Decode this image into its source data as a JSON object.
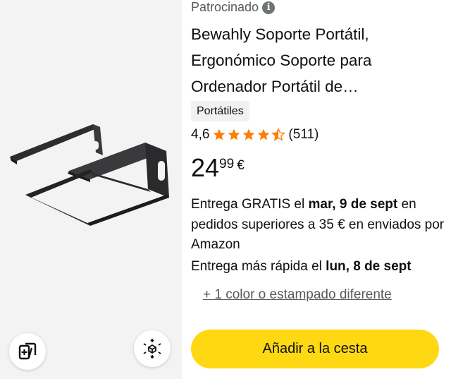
{
  "sponsored_label": "Patrocinado",
  "product": {
    "title": "Bewahly Soporte Portátil, Ergonómico Soporte para Ordenador Portátil de…",
    "category": "Portátiles",
    "rating": "4,6",
    "rating_value": 4.6,
    "rating_max": 5,
    "review_count": "(511)",
    "price_whole": "24",
    "price_fraction": "99",
    "currency": "€"
  },
  "delivery": {
    "line_prefix": "Entrega GRATIS el ",
    "free_date": "mar, 9 de sept",
    "line_suffix": " en pedidos superiores a 35 € en enviados por Amazon",
    "fast_prefix": "Entrega más rápida el ",
    "fast_date": "lun, 8 de sept"
  },
  "variants_link": "+ 1 color o estampado diferente",
  "add_to_cart_label": "Añadir a la cesta",
  "icons": {
    "info": "info-icon",
    "compare": "compare-icon",
    "view_3d": "view-3d-icon",
    "star": "star-icon"
  },
  "colors": {
    "star": "#ff7e00",
    "button": "#ffd814",
    "image_bg": "#f3f3f3",
    "tag_bg": "#f0f2f2",
    "secondary_text": "#565959"
  }
}
